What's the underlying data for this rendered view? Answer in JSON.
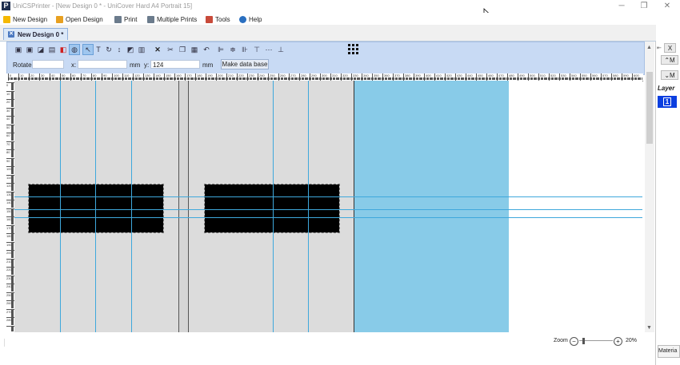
{
  "window": {
    "title": "UniCSPrinter - [New Design 0 * - UniCover Hard A4 Portrait 15]",
    "logo_letter": "P",
    "controls": {
      "minimize": "─",
      "maximize": "❐",
      "close": "✕"
    }
  },
  "menu": [
    {
      "label": "New Design",
      "icon": "new-design-icon",
      "color": "#f5b800"
    },
    {
      "label": "Open Design",
      "icon": "open-folder-icon",
      "color": "#e8a020"
    },
    {
      "label": "Print",
      "icon": "printer-icon",
      "color": "#6b7b8c"
    },
    {
      "label": "Multiple Prints",
      "icon": "multiple-printers-icon",
      "color": "#6b7b8c"
    },
    {
      "label": "Tools",
      "icon": "tools-icon",
      "color": "#c84a3a"
    },
    {
      "label": "Help",
      "icon": "help-icon",
      "color": "#2a6fc0"
    }
  ],
  "tabs": [
    {
      "label": "New Design 0 *",
      "close": "✕"
    }
  ],
  "toolbar": {
    "tools": [
      {
        "name": "save-icon",
        "glyph": "▣"
      },
      {
        "name": "save-as-icon",
        "glyph": "▣"
      },
      {
        "name": "import-icon",
        "glyph": "◪"
      },
      {
        "name": "properties-icon",
        "glyph": "▤"
      },
      {
        "name": "color-icon",
        "glyph": "◧"
      },
      {
        "name": "shape-icon",
        "glyph": "◍"
      },
      {
        "name": "select-tool-icon",
        "glyph": "↖"
      },
      {
        "name": "text-tool-icon",
        "glyph": "T"
      },
      {
        "name": "rotate-tool-icon",
        "glyph": "↻"
      },
      {
        "name": "line-tool-icon",
        "glyph": "↕"
      },
      {
        "name": "image-tool-icon",
        "glyph": "◩"
      },
      {
        "name": "barcode-tool-icon",
        "glyph": "▥"
      },
      {
        "name": "delete-icon",
        "glyph": "✕"
      },
      {
        "name": "cut-icon",
        "glyph": "✂"
      },
      {
        "name": "copy-icon",
        "glyph": "❐"
      },
      {
        "name": "paste-icon",
        "glyph": "▦"
      },
      {
        "name": "undo-icon",
        "glyph": "↶"
      },
      {
        "name": "align-left-icon",
        "glyph": "⊫"
      },
      {
        "name": "align-center-icon",
        "glyph": "≑"
      },
      {
        "name": "align-right-icon",
        "glyph": "⊪"
      },
      {
        "name": "align-top-icon",
        "glyph": "⊤"
      },
      {
        "name": "distribute-icon",
        "glyph": "⋯"
      },
      {
        "name": "align-bottom-icon",
        "glyph": "⊥"
      }
    ],
    "rotate_label": "Rotate:",
    "rotate_value": "",
    "x_label": "x:",
    "x_value": "",
    "x_unit": "mm",
    "y_label": "y:",
    "y_value": "124",
    "y_unit": "mm",
    "make_db_label": "Make data base"
  },
  "ruler": {
    "labels": [
      "0",
      "10",
      "20",
      "30",
      "40",
      "50",
      "60",
      "70",
      "80",
      "90",
      "100",
      "110",
      "120",
      "130",
      "140",
      "150",
      "160",
      "170",
      "180",
      "190",
      "200",
      "210",
      "220",
      "230",
      "240",
      "250",
      "260",
      "270",
      "280",
      "290",
      "300",
      "310",
      "320",
      "330",
      "340",
      "350",
      "360",
      "370",
      "380",
      "390",
      "400",
      "410",
      "420",
      "430",
      "440",
      "450",
      "460",
      "470",
      "480",
      "490",
      "500",
      "510",
      "520",
      "530",
      "540",
      "550",
      "560",
      "570",
      "580",
      "590",
      "600"
    ]
  },
  "vruler": {
    "labels": [
      "0",
      "10",
      "20",
      "30",
      "40",
      "50",
      "60",
      "70",
      "80",
      "90",
      "100",
      "110",
      "120",
      "130",
      "140",
      "150",
      "160",
      "170",
      "180",
      "190",
      "200",
      "210",
      "220",
      "230",
      "240",
      "250",
      "260",
      "270",
      "280",
      "290",
      "300"
    ]
  },
  "colors": {
    "accent": "#88cbe8",
    "page_gray": "#dcdcdc",
    "guide": "#3fa8dc",
    "toolbar": "#c8daf4",
    "selected_layer": "#0b3fe0"
  },
  "right_panel": {
    "close": "X",
    "up": "⌃",
    "m1": "M",
    "m2": "M",
    "layer_label": "Layer",
    "layer_number": "1",
    "material_label": "Materia"
  },
  "status": {
    "zoom_label": "Zoom",
    "zoom_value": "20%",
    "zoom_minus": "−",
    "zoom_plus": "+"
  }
}
